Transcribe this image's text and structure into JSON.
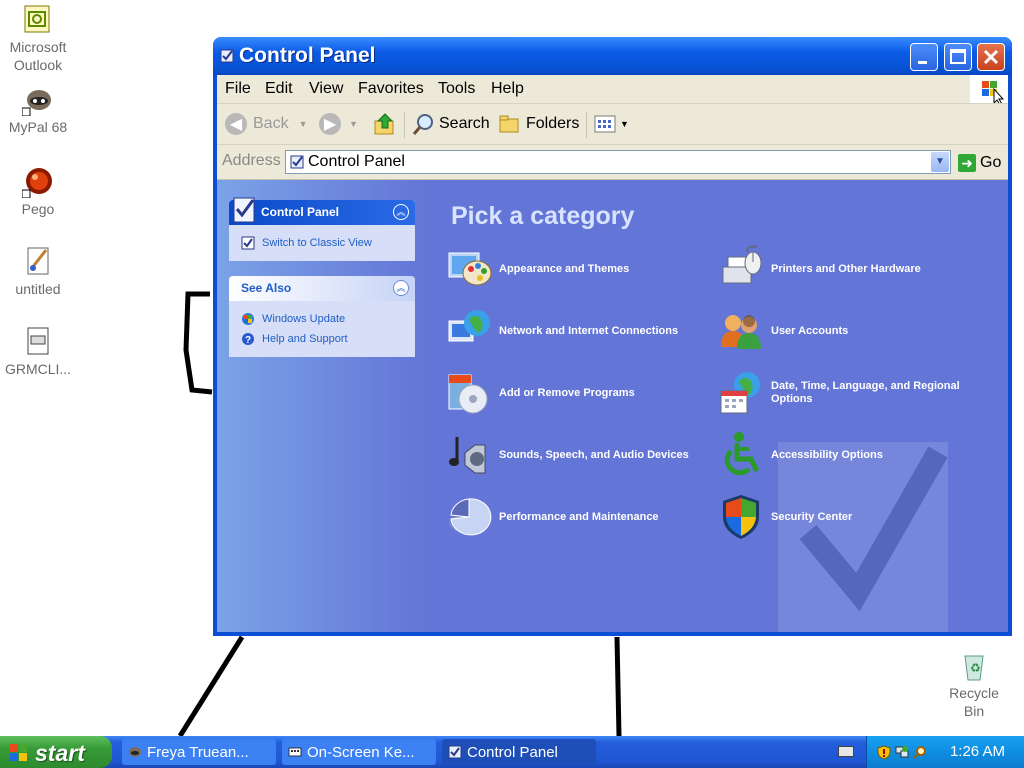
{
  "desktop": {
    "icons": [
      {
        "label": "Microsoft\nOutlook",
        "line1": "Microsoft",
        "line2": "Outlook",
        "icon": "outlook-icon"
      },
      {
        "label": "MyPal 68",
        "icon": "raccoon-icon"
      },
      {
        "label": "Pego",
        "icon": "red-ball-icon"
      },
      {
        "label": "untitled",
        "icon": "paint-file-icon"
      },
      {
        "label": "GRMCLI...",
        "icon": "text-file-icon"
      }
    ],
    "recycle_bin": {
      "line1": "Recycle",
      "line2": "Bin"
    }
  },
  "window": {
    "title": "Control Panel",
    "menu": [
      "File",
      "Edit",
      "View",
      "Favorites",
      "Tools",
      "Help"
    ],
    "toolbar": {
      "back": "Back",
      "search": "Search",
      "folders": "Folders"
    },
    "address": {
      "label": "Address",
      "value": "Control Panel",
      "go": "Go"
    },
    "left_pane": {
      "control_panel_box": {
        "title": "Control Panel",
        "links": [
          "Switch to Classic View"
        ]
      },
      "see_also_box": {
        "title": "See Also",
        "links": [
          "Windows Update",
          "Help and Support"
        ]
      }
    },
    "main": {
      "heading": "Pick a category",
      "categories": [
        {
          "label": "Appearance and Themes",
          "icon": "appearance-themes-icon"
        },
        {
          "label": "Printers and Other Hardware",
          "icon": "printer-icon"
        },
        {
          "label": "Network and Internet Connections",
          "icon": "network-globe-icon"
        },
        {
          "label": "User Accounts",
          "icon": "user-accounts-icon"
        },
        {
          "label": "Add or Remove Programs",
          "icon": "add-remove-programs-icon"
        },
        {
          "label": "Date, Time, Language, and Regional Options",
          "icon": "date-time-globe-icon"
        },
        {
          "label": "Sounds, Speech, and Audio Devices",
          "icon": "speaker-icon"
        },
        {
          "label": "Accessibility Options",
          "icon": "accessibility-icon"
        },
        {
          "label": "Performance and Maintenance",
          "icon": "performance-pie-icon"
        },
        {
          "label": "Security Center",
          "icon": "security-shield-icon"
        }
      ]
    }
  },
  "taskbar": {
    "start": "start",
    "tasks": [
      {
        "label": "Freya Truean...",
        "active": false
      },
      {
        "label": "On-Screen Ke...",
        "active": false
      },
      {
        "label": "Control Panel",
        "active": true
      }
    ],
    "clock": "1:26 AM"
  },
  "colors": {
    "title_blue": "#0b5be6",
    "main_pane": "#6375d6",
    "start_green": "#369b36",
    "tray_blue": "#0f8ee0"
  }
}
